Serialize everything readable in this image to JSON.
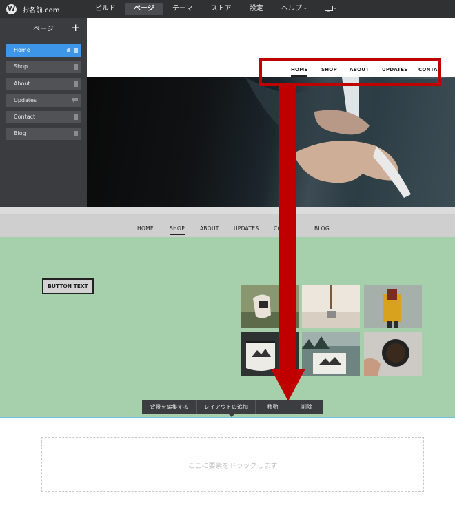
{
  "brand": {
    "name": "お名前.com"
  },
  "menu": [
    {
      "label": "ビルド",
      "active": false
    },
    {
      "label": "ページ",
      "active": true
    },
    {
      "label": "テーマ",
      "active": false
    },
    {
      "label": "ストア",
      "active": false
    },
    {
      "label": "設定",
      "active": false
    },
    {
      "label": "ヘルプ -",
      "active": false
    }
  ],
  "menu_device_suffix": "-",
  "sidebar": {
    "title": "ページ",
    "add_label": "+",
    "items": [
      {
        "label": "Home",
        "active": true
      },
      {
        "label": "Shop",
        "active": false
      },
      {
        "label": "About",
        "active": false
      },
      {
        "label": "Updates",
        "active": false
      },
      {
        "label": "Contact",
        "active": false
      },
      {
        "label": "Blog",
        "active": false
      }
    ]
  },
  "preview_nav": [
    "HOME",
    "SHOP",
    "ABOUT",
    "UPDATES",
    "CONTAC"
  ],
  "section_nav": [
    "HOME",
    "SHOP",
    "ABOUT",
    "UPDATES",
    "CO",
    "BLOG"
  ],
  "section": {
    "button_text": "BUTTON TEXT"
  },
  "toolbar": [
    "背景を編集する",
    "レイアウトの追加",
    "移動",
    "削除"
  ],
  "drop_zone": {
    "text": "ここに要素をドラッグします"
  },
  "colors": {
    "highlight": "#c00000",
    "accent": "#3d96e8",
    "section_bg": "#a5d0ab"
  }
}
